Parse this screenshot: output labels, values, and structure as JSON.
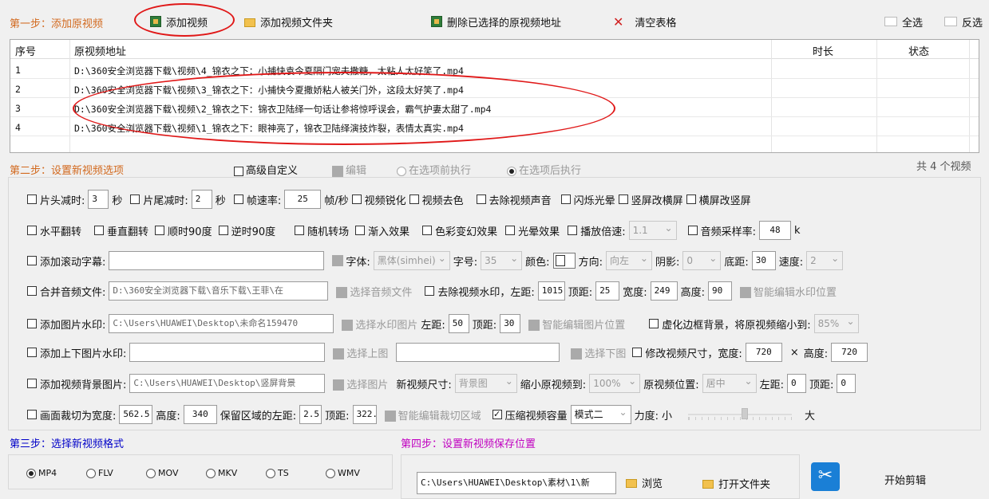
{
  "step1": {
    "title": "第一步：添加原视频",
    "add_video": "添加视频",
    "add_folder": "添加视频文件夹",
    "delete_selected": "删除已选择的原视频地址",
    "clear_table": "清空表格",
    "select_all": "全选",
    "invert": "反选"
  },
  "table": {
    "columns": [
      "序号",
      "原视频地址",
      "时长",
      "状态"
    ],
    "rows": [
      {
        "no": "1",
        "path": "D:\\360安全浏览器下载\\视频\\4_锦衣之下：小捕快袁今夏隔门宠夫撒糖，太粘人太好笑了.mp4",
        "duration": "",
        "status": ""
      },
      {
        "no": "2",
        "path": "D:\\360安全浏览器下载\\视频\\3_锦衣之下：小捕快今夏撒娇粘人被关门外，这段太好笑了.mp4",
        "duration": "",
        "status": ""
      },
      {
        "no": "3",
        "path": "D:\\360安全浏览器下载\\视频\\2_锦衣之下：锦衣卫陆绎一句话让参将惊呼误会，霸气护妻太甜了.mp4",
        "duration": "",
        "status": ""
      },
      {
        "no": "4",
        "path": "D:\\360安全浏览器下载\\视频\\1_锦衣之下：眼神亮了，锦衣卫陆绎演技炸裂，表情太真实.mp4",
        "duration": "",
        "status": ""
      }
    ]
  },
  "step2": {
    "title": "第二步：设置新视频选项",
    "advanced": "高级自定义",
    "edit": "编辑",
    "before": "在选项前执行",
    "after": "在选项后执行",
    "count": "共 4 个视频"
  },
  "r1": {
    "head_cut": "片头减时:",
    "head_val": "3",
    "sec1": "秒",
    "tail_cut": "片尾减时:",
    "tail_val": "2",
    "sec2": "秒",
    "fps": "帧速率:",
    "fps_val": "25",
    "fps_unit": "帧/秒",
    "sharpen": "视频锐化",
    "decolor": "视频去色",
    "mute": "去除视频声音",
    "flash": "闪烁光晕",
    "v2h": "竖屏改横屏",
    "h2v": "横屏改竖屏"
  },
  "r2": {
    "hflip": "水平翻转",
    "vflip": "垂直翻转",
    "cw90": "顺时90度",
    "ccw90": "逆时90度",
    "random": "随机转场",
    "fadein": "渐入效果",
    "colorfx": "色彩变幻效果",
    "glow": "光晕效果",
    "speed": "播放倍速:",
    "speed_val": "1.1",
    "samplerate": "音频采样率:",
    "samplerate_val": "48",
    "k": "k"
  },
  "r3": {
    "scroll": "添加滚动字幕:",
    "font": "字体:",
    "font_val": "黑体(simhei)",
    "size": "字号:",
    "size_val": "35",
    "color": "颜色:",
    "dir": "方向:",
    "dir_val": "向左",
    "shadow": "阴影:",
    "shadow_val": "0",
    "bottom": "底距:",
    "bottom_val": "30",
    "speed": "速度:",
    "speed_val": "2"
  },
  "r4": {
    "merge": "合并音频文件:",
    "path": "D:\\360安全浏览器下载\\音乐下载\\王菲\\在",
    "choose": "选择音频文件",
    "rm_wm": "去除视频水印，左距:",
    "left": "1015",
    "top_lbl": "顶距:",
    "top": "25",
    "width_lbl": "宽度:",
    "width": "249",
    "height_lbl": "高度:",
    "height": "90",
    "smart": "智能编辑水印位置"
  },
  "r5": {
    "img_wm": "添加图片水印:",
    "path": "C:\\Users\\HUAWEI\\Desktop\\未命名159470",
    "choose": "选择水印图片",
    "left_lbl": "左距:",
    "left": "50",
    "top_lbl": "顶距:",
    "top": "30",
    "smart": "智能编辑图片位置",
    "blur": "虚化边框背景，将原视频缩小到:",
    "blur_val": "85%"
  },
  "r6": {
    "updown": "添加上下图片水印:",
    "choose_top": "选择上图",
    "choose_bottom": "选择下图",
    "resize": "修改视频尺寸，宽度:",
    "w": "720",
    "x": "×",
    "h_lbl": "高度:",
    "h": "720"
  },
  "r7": {
    "bg": "添加视频背景图片:",
    "path": "C:\\Users\\HUAWEI\\Desktop\\竖屏背景",
    "choose": "选择图片",
    "newsize": "新视频尺寸:",
    "newsize_val": "背景图",
    "shrink": "缩小原视频到:",
    "shrink_val": "100%",
    "pos": "原视频位置:",
    "pos_val": "居中",
    "left_lbl": "左距:",
    "left": "0",
    "top_lbl": "顶距:",
    "top": "0"
  },
  "r8": {
    "crop": "画面裁切为宽度:",
    "w": "562.5",
    "h_lbl": "高度:",
    "h": "340",
    "keep": "保留区域的左距:",
    "left": "2.5",
    "top_lbl": "顶距:",
    "top": "322.",
    "smart": "智能编辑裁切区域",
    "compress": "压缩视频容量",
    "mode": "模式二",
    "force": "力度:",
    "small": "小",
    "big": "大",
    "force_level": 0.55
  },
  "step3": {
    "title": "第三步：选择新视频格式",
    "formats": [
      "MP4",
      "FLV",
      "MOV",
      "MKV",
      "TS",
      "WMV"
    ],
    "selected": "MP4"
  },
  "step4": {
    "title": "第四步：设置新视频保存位置",
    "path": "C:\\Users\\HUAWEI\\Desktop\\素材\\1\\新",
    "browse": "浏览",
    "open": "打开文件夹",
    "start": "开始剪辑"
  }
}
